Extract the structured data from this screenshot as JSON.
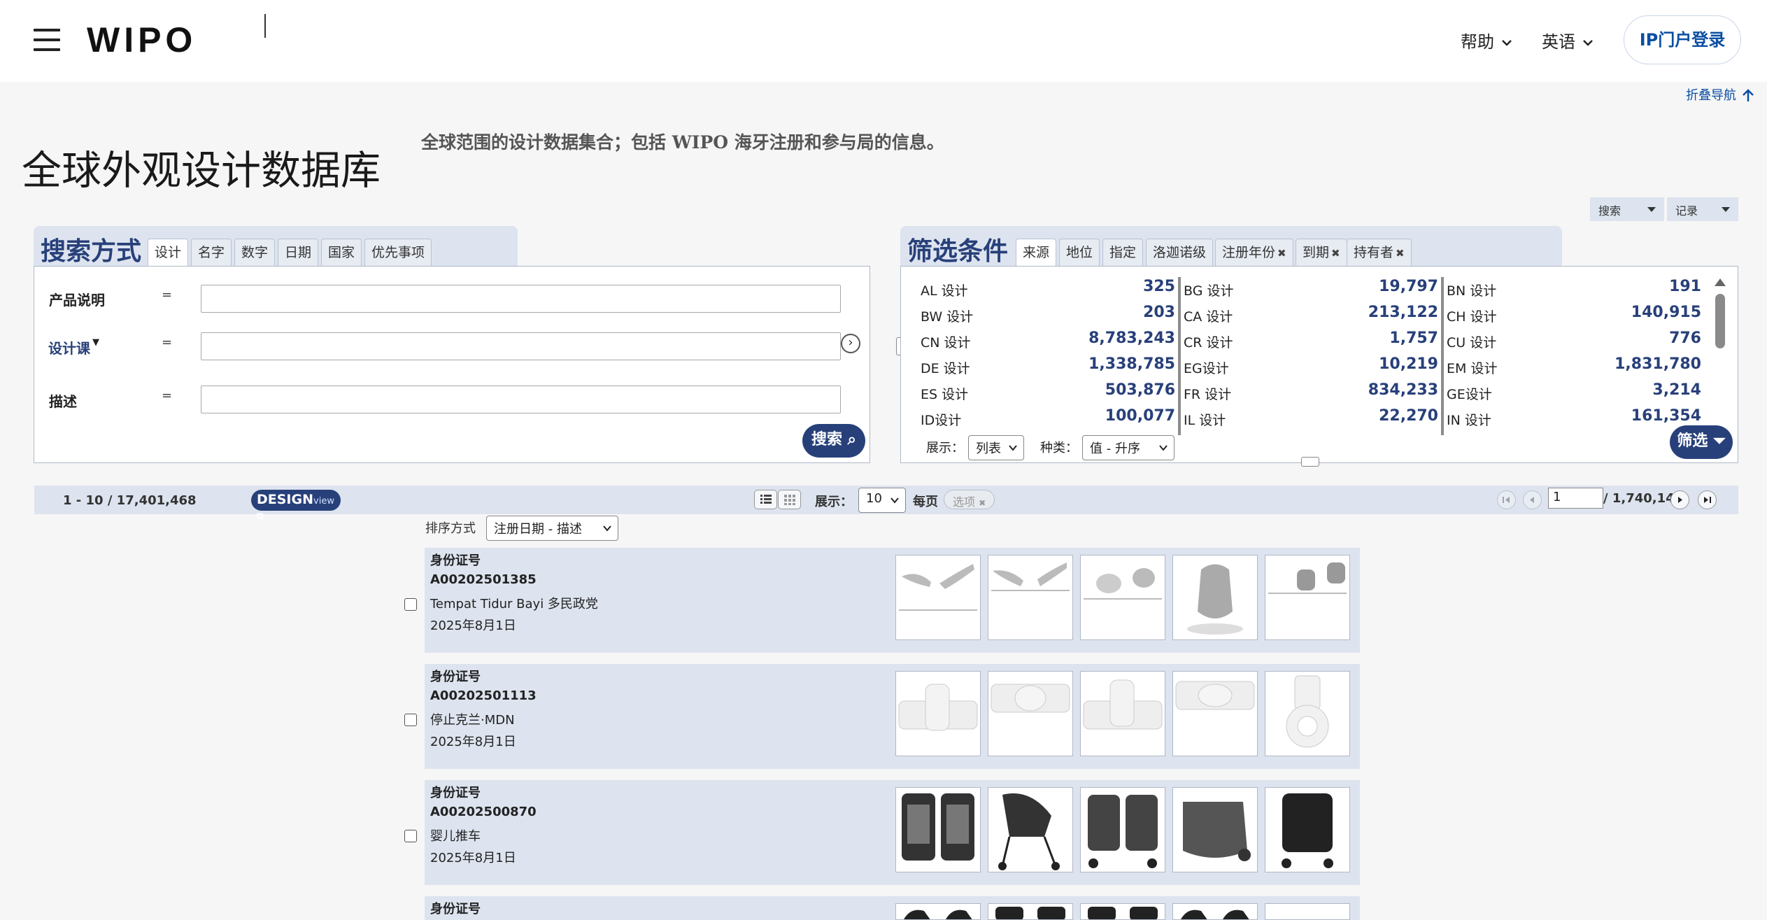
{
  "header": {
    "logo": "WIPO",
    "help": "帮助",
    "language": "英语",
    "login": "IP门户登录",
    "collapse_nav": "折叠导航"
  },
  "page": {
    "title": "全球外观设计数据库",
    "subtitle": "全球范围的设计数据集合；包括 WIPO 海牙注册和参与局的信息。"
  },
  "top_selects": {
    "search": "搜索",
    "record": "记录"
  },
  "search_panel": {
    "heading": "搜索方式",
    "tabs": [
      "设计",
      "名字",
      "数字",
      "日期",
      "国家",
      "优先事项"
    ],
    "fields": [
      {
        "label": "产品说明",
        "op": "=",
        "value": ""
      },
      {
        "label": "设计课",
        "op": "=",
        "value": ""
      },
      {
        "label": "描述",
        "op": "=",
        "value": ""
      }
    ],
    "search_button": "搜索 ⌕"
  },
  "filter_panel": {
    "heading": "筛选条件",
    "tabs": [
      "来源",
      "地位",
      "指定",
      "洛迦诺级",
      "注册年份",
      "到期",
      "持有者"
    ],
    "columns": [
      [
        {
          "name": "AL 设计",
          "count": "325"
        },
        {
          "name": "BW 设计",
          "count": "203"
        },
        {
          "name": "CN 设计",
          "count": "8,783,243"
        },
        {
          "name": "DE 设计",
          "count": "1,338,785"
        },
        {
          "name": "ES 设计",
          "count": "503,876"
        },
        {
          "name": "ID设计",
          "count": "100,077"
        }
      ],
      [
        {
          "name": "BG 设计",
          "count": "19,797"
        },
        {
          "name": "CA 设计",
          "count": "213,122"
        },
        {
          "name": "CR 设计",
          "count": "1,757"
        },
        {
          "name": "EG设计",
          "count": "10,219"
        },
        {
          "name": "FR 设计",
          "count": "834,233"
        },
        {
          "name": "IL 设计",
          "count": "22,270"
        }
      ],
      [
        {
          "name": "BN 设计",
          "count": "191"
        },
        {
          "name": "CH 设计",
          "count": "140,915"
        },
        {
          "name": "CU 设计",
          "count": "776"
        },
        {
          "name": "EM 设计",
          "count": "1,831,780"
        },
        {
          "name": "GE设计",
          "count": "3,214"
        },
        {
          "name": "IN 设计",
          "count": "161,354"
        }
      ]
    ],
    "display_label": "展示：",
    "display_value": "列表",
    "kind_label": "种类：",
    "kind_value": "值 - 升序",
    "filter_button": "筛选 ⏷"
  },
  "results_bar": {
    "range": "1 - 10 / 17,401,468",
    "designview": "DESIGN",
    "designview_small": "view",
    "display_label": "展示：",
    "per_page": "10",
    "per_page_label": "每页",
    "options_label": "选项",
    "page_value": "1",
    "page_total": "/ 1,740,147"
  },
  "sort": {
    "label": "排序方式",
    "value": "注册日期 - 描述"
  },
  "results": [
    {
      "id_label": "身份证号",
      "id": "A00202501385",
      "title": "Tempat Tidur Bayi 多民政党",
      "date": "2025年8月1日",
      "thumb_kind": "bouncer"
    },
    {
      "id_label": "身份证号",
      "id": "A00202501113",
      "title": "停止克兰·MDN",
      "date": "2025年8月1日",
      "thumb_kind": "valve"
    },
    {
      "id_label": "身份证号",
      "id": "A00202500870",
      "title": "婴儿推车",
      "date": "2025年8月1日",
      "thumb_kind": "stroller"
    },
    {
      "id_label": "身份证号",
      "id": "",
      "title": "",
      "date": "",
      "thumb_kind": "partial"
    }
  ],
  "colors": {
    "accent": "#28407a",
    "panel": "#dde4ef",
    "link": "#0b4ea2"
  }
}
